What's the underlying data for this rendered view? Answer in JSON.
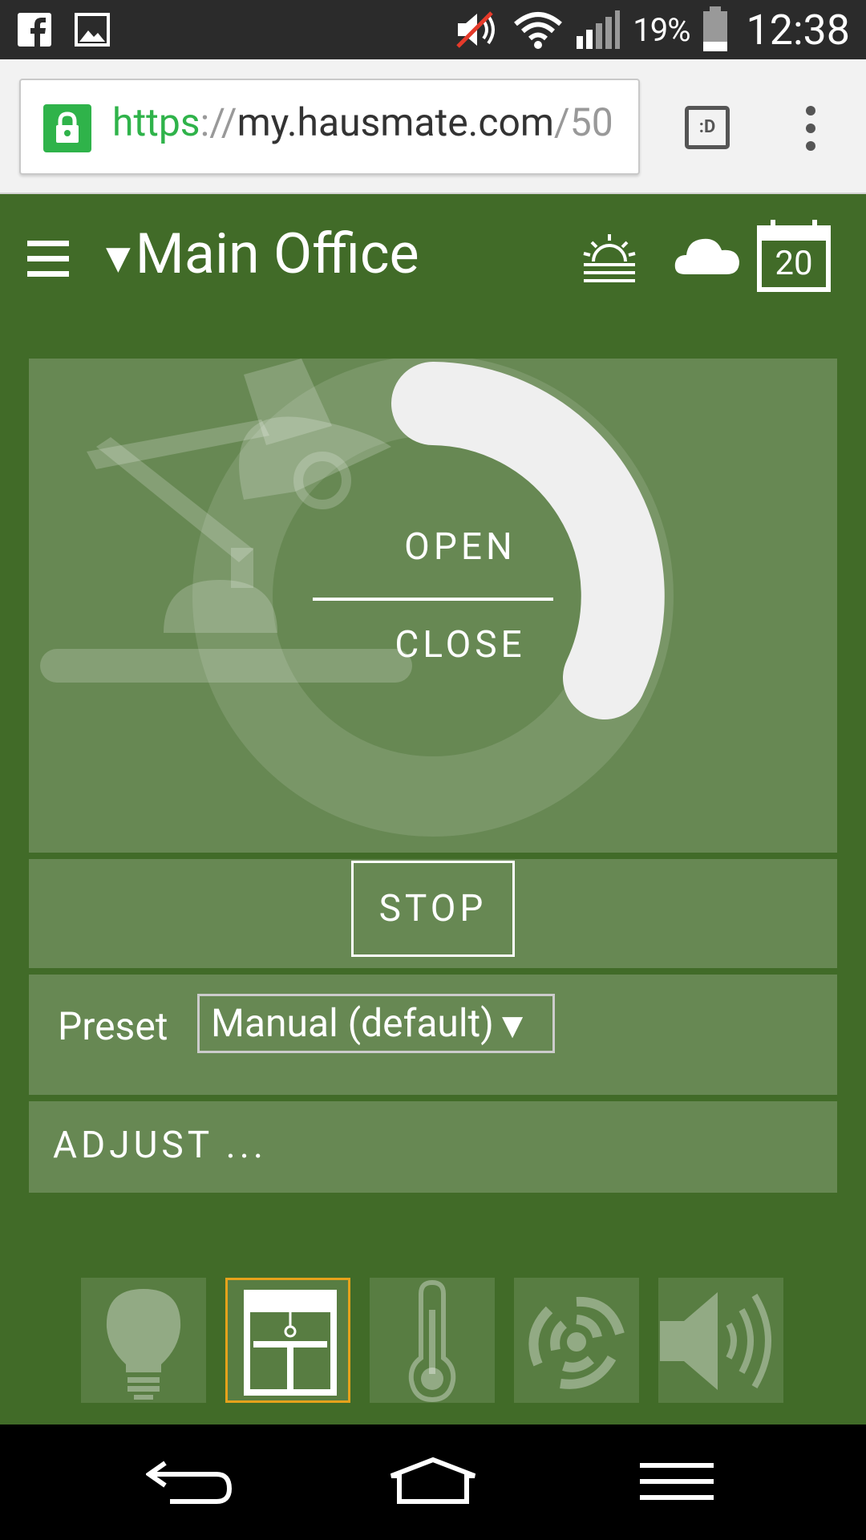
{
  "status_bar": {
    "battery_percent": "19%",
    "time": "12:38",
    "icons": [
      "facebook-icon",
      "gallery-icon",
      "muted-speaker-icon",
      "wifi-icon",
      "signal-icon",
      "battery-icon"
    ]
  },
  "browser": {
    "url_scheme": "https",
    "url_sep": "://",
    "url_host": "my.hausmate.com",
    "url_path": "/50",
    "tabs_label": ":D"
  },
  "app": {
    "room_arrow": "▼",
    "room_name": "Main Office",
    "calendar_day": "20",
    "background_color": "#416b28",
    "accent_color": "#e6a21b"
  },
  "shade_control": {
    "open_label": "OPEN",
    "close_label": "CLOSE",
    "position_fraction": 0.35,
    "stop_label": "STOP"
  },
  "preset": {
    "label": "Preset",
    "selected": "Manual (default)",
    "arrow": "▼"
  },
  "adjust": {
    "label": "ADJUST ..."
  },
  "device_tabs": [
    {
      "icon": "lightbulb-icon",
      "active": false
    },
    {
      "icon": "window-shade-icon",
      "active": true
    },
    {
      "icon": "thermometer-icon",
      "active": false
    },
    {
      "icon": "fan-icon",
      "active": false
    },
    {
      "icon": "speaker-icon",
      "active": false
    }
  ]
}
